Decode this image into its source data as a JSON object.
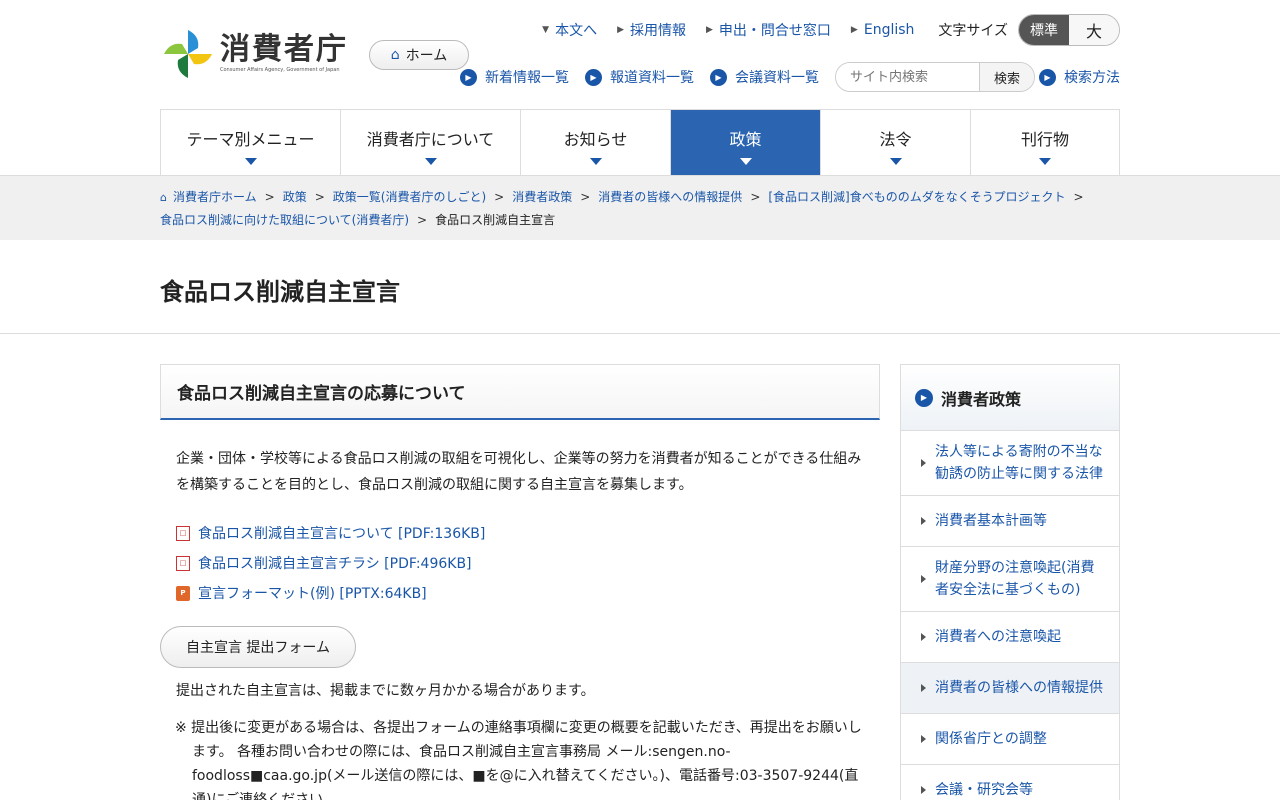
{
  "header": {
    "logo_text": "消費者庁",
    "logo_sub": "Consumer Affairs Agency, Government of Japan",
    "home_label": "ホーム",
    "utility_links": [
      "本文へ",
      "採用情報",
      "申出・問合せ窓口",
      "English"
    ],
    "font_size_label": "文字サイズ",
    "font_standard": "標準",
    "font_large": "大",
    "quick_links": [
      "新着情報一覧",
      "報道資料一覧",
      "会議資料一覧"
    ],
    "search_placeholder": "サイト内検索",
    "search_button": "検索",
    "search_howto": "検索方法"
  },
  "nav": [
    {
      "label": "テーマ別メニュー",
      "active": false
    },
    {
      "label": "消費者庁について",
      "active": false
    },
    {
      "label": "お知らせ",
      "active": false
    },
    {
      "label": "政策",
      "active": true
    },
    {
      "label": "法令",
      "active": false
    },
    {
      "label": "刊行物",
      "active": false
    }
  ],
  "breadcrumb": {
    "items": [
      "消費者庁ホーム",
      "政策",
      "政策一覧(消費者庁のしごと)",
      "消費者政策",
      "消費者の皆様への情報提供",
      "[食品ロス削減]食べもののムダをなくそうプロジェクト",
      "食品ロス削減に向けた取組について(消費者庁)"
    ],
    "current": "食品ロス削減自主宣言"
  },
  "page_title": "食品ロス削減自主宣言",
  "main": {
    "section_title": "食品ロス削減自主宣言の応募について",
    "intro": "企業・団体・学校等による食品ロス削減の取組を可視化し、企業等の努力を消費者が知ることができる仕組みを構築することを目的とし、食品ロス削減の取組に関する自主宣言を募集します。",
    "files": [
      {
        "type": "pdf",
        "label": "食品ロス削減自主宣言について [PDF:136KB]"
      },
      {
        "type": "pdf",
        "label": "食品ロス削減自主宣言チラシ [PDF:496KB]"
      },
      {
        "type": "pptx",
        "label": "宣言フォーマット(例) [PPTX:64KB]"
      }
    ],
    "form_button": "自主宣言 提出フォーム",
    "note1": "提出された自主宣言は、掲載までに数ヶ月かかる場合があります。",
    "note2": "※ 提出後に変更がある場合は、各提出フォームの連絡事項欄に変更の概要を記載いただき、再提出をお願いします。 各種お問い合わせの際には、食品ロス削減自主宣言事務局 メール:sengen.no-foodloss■caa.go.jp(メール送信の際には、■を@に入れ替えてください。)、電話番号:03-3507-9244(直通)にご連絡ください。"
  },
  "sidebar": {
    "title": "消費者政策",
    "items": [
      {
        "label": "法人等による寄附の不当な勧誘の防止等に関する法律",
        "active": false
      },
      {
        "label": "消費者基本計画等",
        "active": false
      },
      {
        "label": "財産分野の注意喚起(消費者安全法に基づくもの)",
        "active": false
      },
      {
        "label": "消費者への注意喚起",
        "active": false
      },
      {
        "label": "消費者の皆様への情報提供",
        "active": true
      },
      {
        "label": "関係省庁との調整",
        "active": false
      },
      {
        "label": "会議・研究会等",
        "active": false
      }
    ]
  },
  "colors": {
    "accent": "#2b64b0",
    "link": "#1a56a8"
  }
}
